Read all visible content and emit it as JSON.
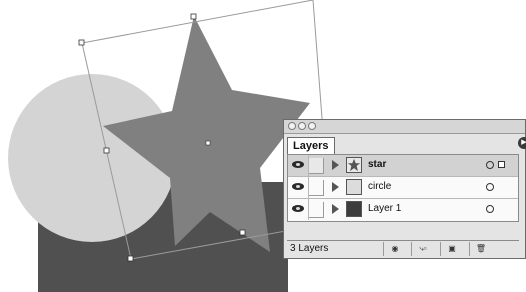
{
  "canvas": {
    "colors": {
      "circle": "#d4d4d4",
      "star": "#808080",
      "rectangle": "#505050"
    }
  },
  "layers_palette": {
    "tab_label": "Layers",
    "layers": [
      {
        "name": "star",
        "selected": true
      },
      {
        "name": "circle",
        "selected": false
      },
      {
        "name": "Layer 1",
        "selected": false
      }
    ],
    "status": "3 Layers",
    "icons": [
      "eye-icon",
      "expand-arrow-icon",
      "target-circle-icon",
      "make-clipping-mask-icon",
      "new-sublayer-icon",
      "new-layer-icon",
      "trash-icon"
    ]
  }
}
